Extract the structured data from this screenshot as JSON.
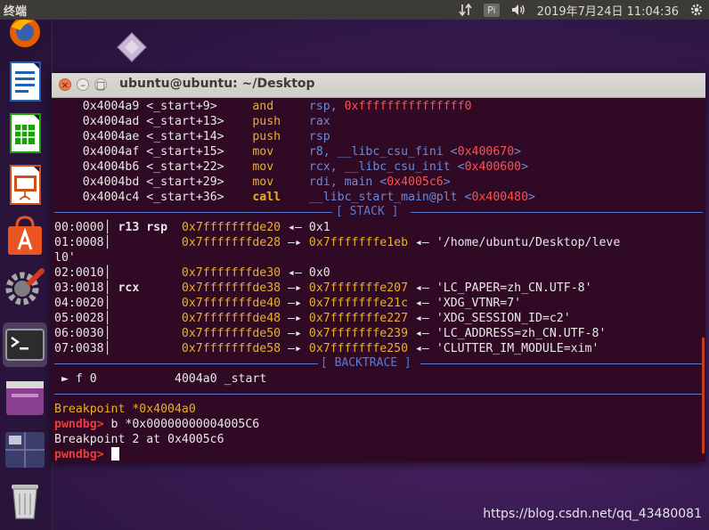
{
  "topbar": {
    "app_title": "终端",
    "indicator_pi": "Pi",
    "clock": "2019年7月24日 11:04:36"
  },
  "window": {
    "title": "ubuntu@ubuntu: ~/Desktop",
    "close_glyph": "×",
    "min_glyph": "–",
    "max_glyph": "□"
  },
  "disasm": [
    {
      "addr": "0x4004a9",
      "sym": "<_start+9>",
      "op": "and",
      "args": "rsp, ",
      "extra": "0xfffffffffffffff0",
      "tail": ""
    },
    {
      "addr": "0x4004ad",
      "sym": "<_start+13>",
      "op": "push",
      "args": "rax",
      "extra": "",
      "tail": ""
    },
    {
      "addr": "0x4004ae",
      "sym": "<_start+14>",
      "op": "push",
      "args": "rsp",
      "extra": "",
      "tail": ""
    },
    {
      "addr": "0x4004af",
      "sym": "<_start+15>",
      "op": "mov",
      "args": "r8, __libc_csu_fini <",
      "extra": "0x400670",
      "tail": ">"
    },
    {
      "addr": "0x4004b6",
      "sym": "<_start+22>",
      "op": "mov",
      "args": "rcx, __libc_csu_init <",
      "extra": "0x400600",
      "tail": ">"
    },
    {
      "addr": "0x4004bd",
      "sym": "<_start+29>",
      "op": "mov",
      "args": "rdi, main <",
      "extra": "0x4005c6",
      "tail": ">"
    },
    {
      "addr": "0x4004c4",
      "sym": "<_start+36>",
      "op": "call",
      "args": "__libc_start_main@plt <",
      "extra": "0x400480",
      "tail": ">"
    }
  ],
  "stack_header": "[ STACK ]",
  "stack": [
    {
      "idx": "00:0000",
      "reg": "r13 rsp",
      "addr": "0x7fffffffde20",
      "arrow1": "◂—",
      "ptr": "",
      "arrow2": "",
      "val": "0x1"
    },
    {
      "idx": "01:0008",
      "reg": "",
      "addr": "0x7fffffffde28",
      "arrow1": "—▸",
      "ptr": "0x7fffffffe1eb",
      "arrow2": "◂—",
      "val": "'/home/ubuntu/Desktop/leve"
    },
    {
      "idx": "",
      "reg": "",
      "addr": "",
      "arrow1": "",
      "ptr": "",
      "arrow2": "",
      "val": "l0'"
    },
    {
      "idx": "02:0010",
      "reg": "",
      "addr": "0x7fffffffde30",
      "arrow1": "◂—",
      "ptr": "",
      "arrow2": "",
      "val": "0x0"
    },
    {
      "idx": "03:0018",
      "reg": "rcx",
      "addr": "0x7fffffffde38",
      "arrow1": "—▸",
      "ptr": "0x7fffffffe207",
      "arrow2": "◂—",
      "val": "'LC_PAPER=zh_CN.UTF-8'"
    },
    {
      "idx": "04:0020",
      "reg": "",
      "addr": "0x7fffffffde40",
      "arrow1": "—▸",
      "ptr": "0x7fffffffe21c",
      "arrow2": "◂—",
      "val": "'XDG_VTNR=7'"
    },
    {
      "idx": "05:0028",
      "reg": "",
      "addr": "0x7fffffffde48",
      "arrow1": "—▸",
      "ptr": "0x7fffffffe227",
      "arrow2": "◂—",
      "val": "'XDG_SESSION_ID=c2'"
    },
    {
      "idx": "06:0030",
      "reg": "",
      "addr": "0x7fffffffde50",
      "arrow1": "—▸",
      "ptr": "0x7fffffffe239",
      "arrow2": "◂—",
      "val": "'LC_ADDRESS=zh_CN.UTF-8'"
    },
    {
      "idx": "07:0038",
      "reg": "",
      "addr": "0x7fffffffde58",
      "arrow1": "—▸",
      "ptr": "0x7fffffffe250",
      "arrow2": "◂—",
      "val": "'CLUTTER_IM_MODULE=xim'"
    }
  ],
  "backtrace_header": "[ BACKTRACE ]",
  "backtrace": {
    "marker": "►",
    "frame": "f 0",
    "addr": "4004a0",
    "sym": "_start"
  },
  "console": {
    "breakpoint_msg": "Breakpoint *0x4004a0",
    "prompt": "pwndbg>",
    "cmd1": " b *0x00000000004005C6",
    "out1": "Breakpoint 2 at 0x4005c6",
    "prompt2": "pwndbg>"
  },
  "watermark": "https://blog.csdn.net/qq_43480081",
  "colors": {
    "terminal_bg": "#300a24",
    "address_yellow": "#e9b028",
    "pointer_red": "#ff5050",
    "divider_blue": "#5c7bcf",
    "prompt_red": "#ee3b3b"
  }
}
